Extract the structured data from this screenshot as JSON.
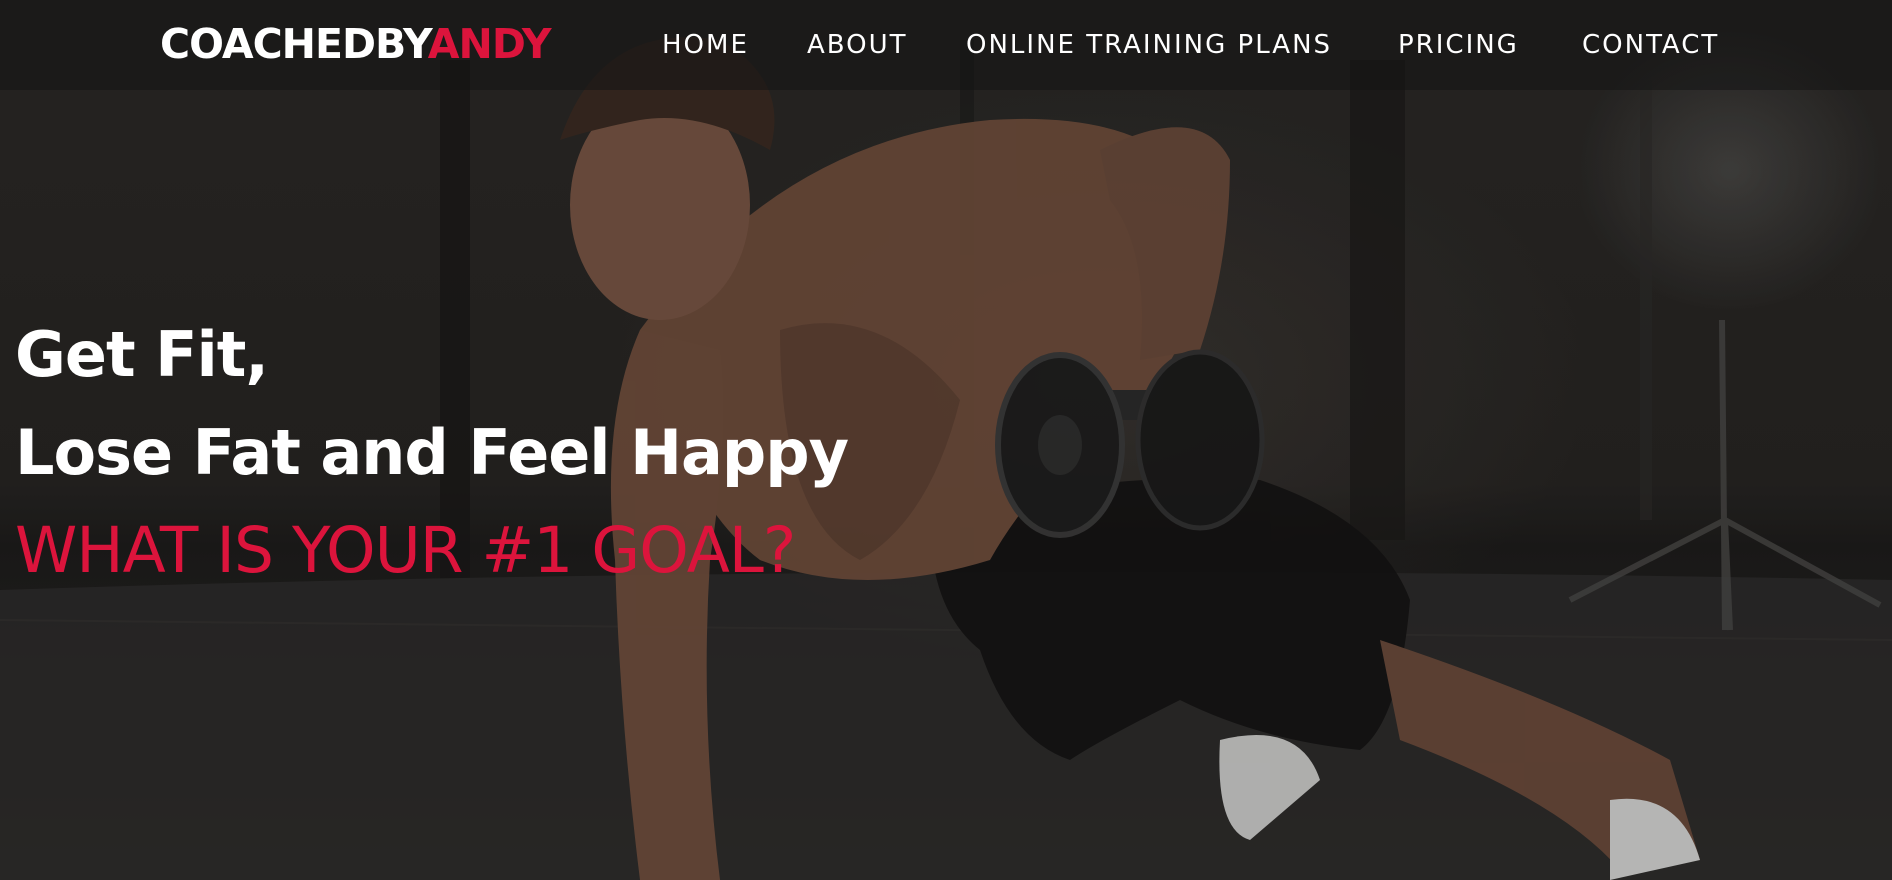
{
  "brand": {
    "logo_main": "COACHEDBY",
    "logo_accent": "ANDY",
    "accent_color": "#dc143c"
  },
  "nav": {
    "items": [
      {
        "label": "HOME"
      },
      {
        "label": "ABOUT"
      },
      {
        "label": "ONLINE TRAINING PLANS"
      },
      {
        "label": "PRICING"
      },
      {
        "label": "CONTACT"
      }
    ]
  },
  "hero": {
    "line1": "Get Fit,",
    "line2": "Lose Fat and Feel Happy",
    "tagline": "WHAT IS YOUR #1 GOAL?",
    "image_subject": "man-doing-dumbbell-row-plank"
  }
}
